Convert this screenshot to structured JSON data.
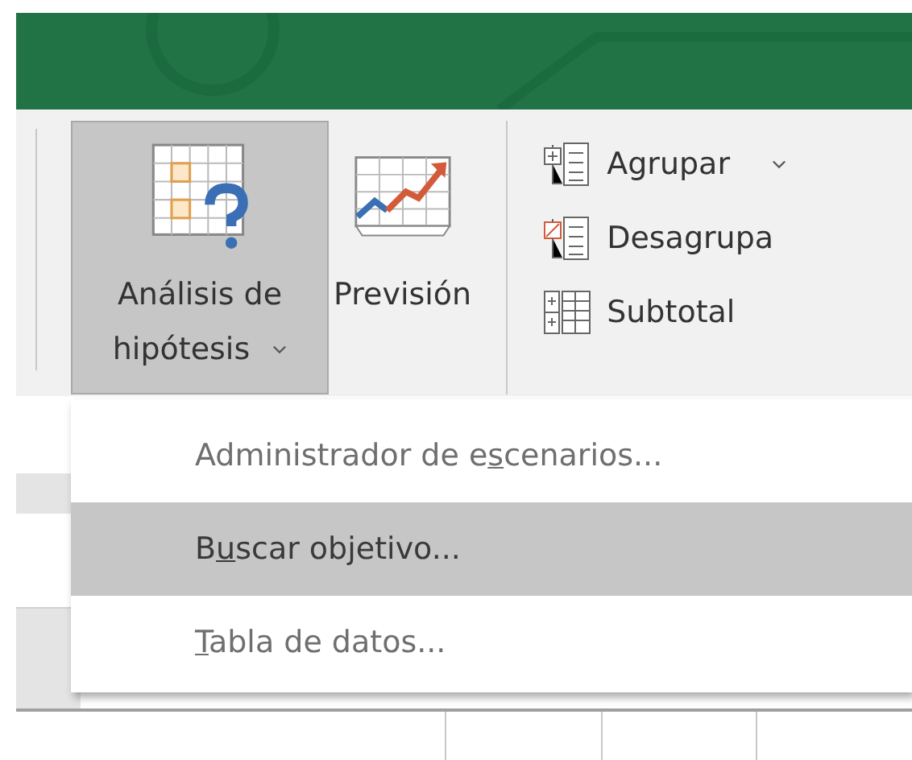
{
  "ribbon": {
    "large_buttons": [
      {
        "kind": "what-if",
        "label_lines": [
          "Análisis de",
          "hipótesis"
        ],
        "has_dropdown": true,
        "selected": true
      },
      {
        "kind": "forecast",
        "label_lines": [
          "Previsión"
        ],
        "has_dropdown": false,
        "selected": false
      }
    ],
    "outline_commands": [
      {
        "kind": "group",
        "label": "Agrupar",
        "has_dropdown": true
      },
      {
        "kind": "ungroup",
        "label": "Desagrupa",
        "has_dropdown": false
      },
      {
        "kind": "subtotal",
        "label": "Subtotal",
        "has_dropdown": false
      }
    ]
  },
  "menu": {
    "items": [
      {
        "before": "Administrador de e",
        "key": "s",
        "after": "cenarios...",
        "selected": false
      },
      {
        "before": "B",
        "key": "u",
        "after": "scar objetivo...",
        "selected": true
      },
      {
        "key": "T",
        "after": "abla de datos...",
        "selected": false
      }
    ]
  }
}
